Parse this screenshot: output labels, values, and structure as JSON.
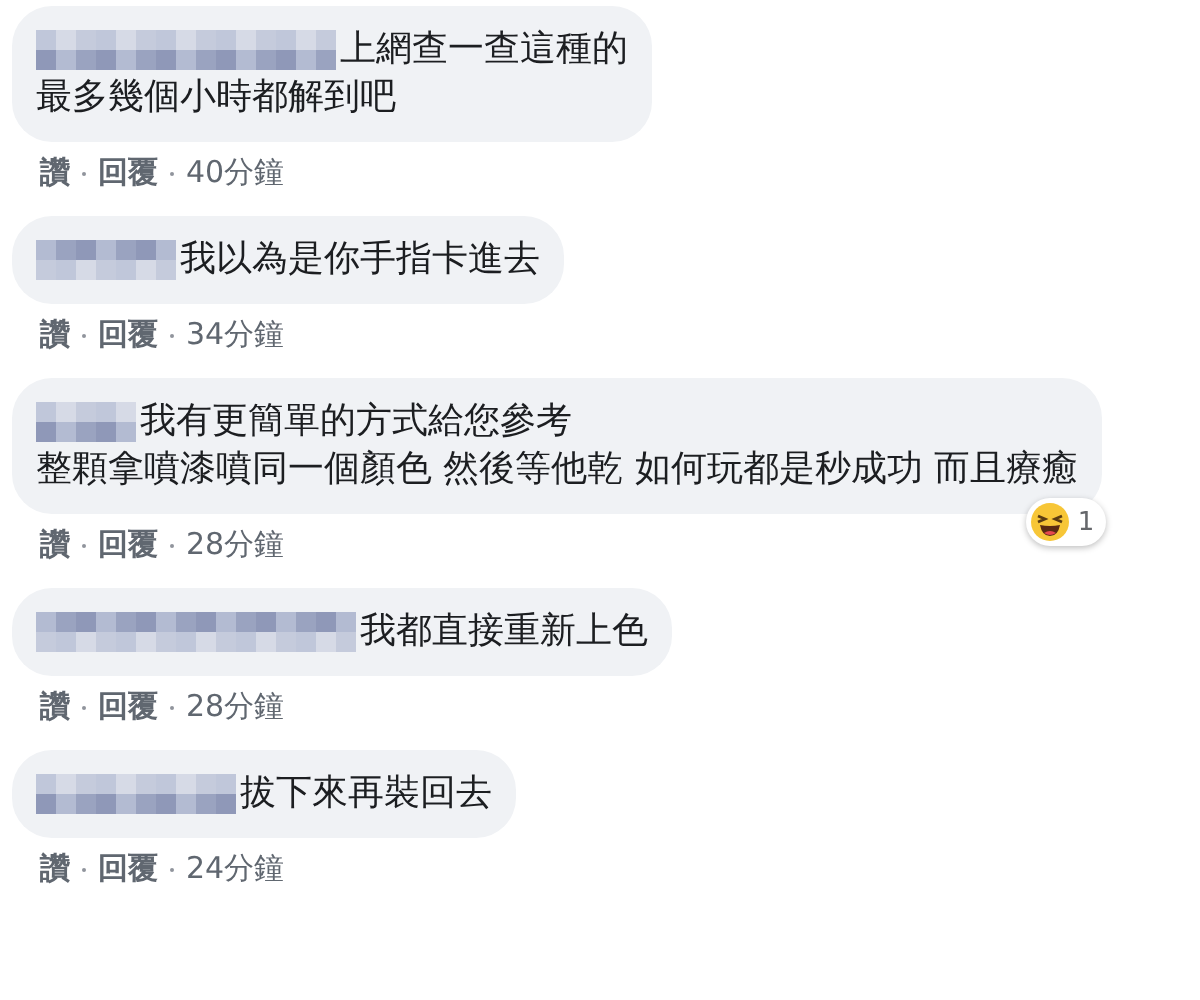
{
  "comments": [
    {
      "lines": [
        "上網查一查這種的",
        "最多幾個小時都解到吧"
      ],
      "actions": {
        "like": "讚",
        "reply": "回覆",
        "time": "40分鐘"
      }
    },
    {
      "lines": [
        "我以為是你手指卡進去"
      ],
      "actions": {
        "like": "讚",
        "reply": "回覆",
        "time": "34分鐘"
      }
    },
    {
      "lines": [
        "我有更簡單的方式給您參考",
        "整顆拿噴漆噴同一個顏色 然後等他乾 如何玩都是秒成功 而且療癒"
      ],
      "actions": {
        "like": "讚",
        "reply": "回覆",
        "time": "28分鐘"
      },
      "reaction": {
        "count": "1"
      }
    },
    {
      "lines": [
        "我都直接重新上色"
      ],
      "actions": {
        "like": "讚",
        "reply": "回覆",
        "time": "28分鐘"
      }
    },
    {
      "lines": [
        "拔下來再裝回去"
      ],
      "actions": {
        "like": "讚",
        "reply": "回覆",
        "time": "24分鐘"
      }
    }
  ]
}
